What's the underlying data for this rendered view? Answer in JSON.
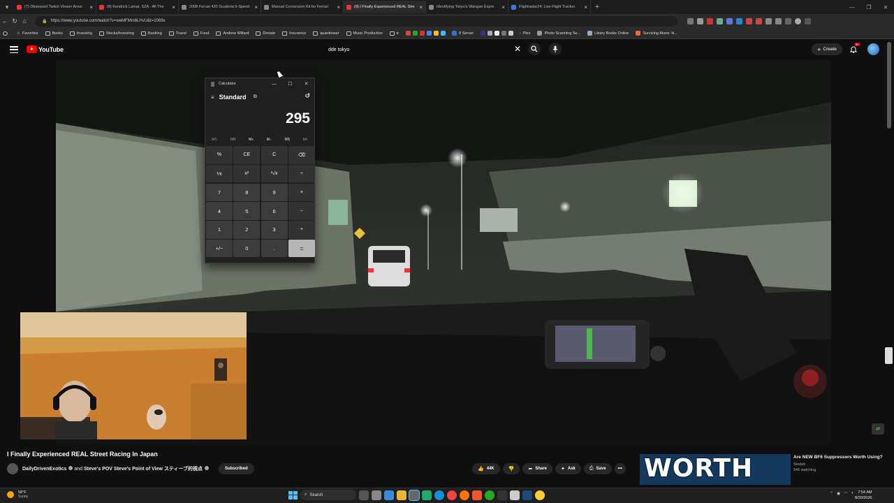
{
  "browser": {
    "tabs": [
      {
        "title": "(7) Obsessed Twitch Viewer Arres",
        "active": false
      },
      {
        "title": "(8) Kendrick Lamar, SZA - All The",
        "active": false
      },
      {
        "title": "2008 Ferrari 430 Scuderia 6-Speed",
        "active": false
      },
      {
        "title": "Manual Conversion Kit for Ferrari",
        "active": false
      },
      {
        "title": "(9) I Finally Experienced REAL Stre",
        "active": true
      },
      {
        "title": "Identifying Tokyo's Wangan Expre",
        "active": false
      },
      {
        "title": "Flightradar24: Live Flight Tracker",
        "active": false
      }
    ],
    "url": "https://www.youtube.com/watch?v=weMFMm6LHvU&t=1069s",
    "bookmarks": [
      {
        "label": "Favorites",
        "type": "star"
      },
      {
        "label": "Books",
        "type": "folder"
      },
      {
        "label": "Investing",
        "type": "folder"
      },
      {
        "label": "Stocks/Investing",
        "type": "folder"
      },
      {
        "label": "Banking",
        "type": "folder"
      },
      {
        "label": "Travel",
        "type": "folder"
      },
      {
        "label": "Food",
        "type": "folder"
      },
      {
        "label": "Andrew Willard",
        "type": "folder"
      },
      {
        "label": "Donate",
        "type": "folder"
      },
      {
        "label": "Insurance",
        "type": "folder"
      },
      {
        "label": "quanttower",
        "type": "folder"
      },
      {
        "label": "Music Production",
        "type": "folder"
      },
      {
        "label": "tr",
        "type": "folder"
      },
      {
        "label": "8 Server",
        "type": "site"
      },
      {
        "label": "Plex",
        "type": "site"
      },
      {
        "label": "Photo Scanning Se...",
        "type": "site"
      },
      {
        "label": "Libary Books Online",
        "type": "site"
      },
      {
        "label": "Surviving Alone: H...",
        "type": "site"
      }
    ]
  },
  "youtube": {
    "logo_text": "YouTube",
    "search_query": "dde tokyo",
    "create_label": "Create",
    "notifications_badge": "9+",
    "video_title": "I Finally Experienced REAL Street Racing In Japan",
    "channel_text": "DailyDrivenExotics",
    "channel_and": "and",
    "channel_collab": "Steve's POV Steve's Point of View スティーブ的視点",
    "subscribe_label": "Subscribed",
    "likes": "44K",
    "share_label": "Share",
    "ask_label": "Ask",
    "save_label": "Save",
    "recommended": {
      "thumb_text": "WORTH IT?",
      "title": "Are NEW BF6 Suppressors Worth Using?",
      "channel": "Stodeh",
      "watching": "546 watching"
    }
  },
  "calculator": {
    "window_title": "Calculator",
    "mode": "Standard",
    "display": "295",
    "memory_buttons": [
      "MC",
      "MR",
      "M+",
      "M−",
      "MS",
      "M˅"
    ],
    "keys": [
      "%",
      "CE",
      "C",
      "⌫",
      "⅟x",
      "x²",
      "²√x",
      "÷",
      "7",
      "8",
      "9",
      "×",
      "4",
      "5",
      "6",
      "−",
      "1",
      "2",
      "3",
      "+",
      "+/−",
      "0",
      ".",
      "="
    ]
  },
  "taskbar": {
    "temperature": "58°F",
    "condition": "Sunny",
    "search_label": "Search",
    "time": "7:54 AM",
    "date": "8/20/2026"
  }
}
